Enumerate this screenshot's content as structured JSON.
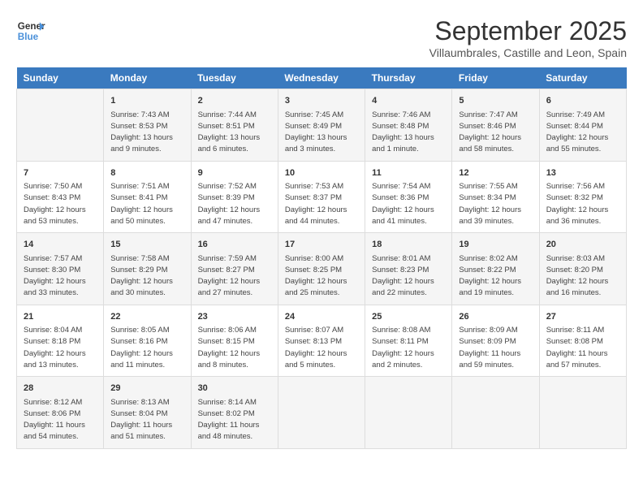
{
  "header": {
    "logo_line1": "General",
    "logo_line2": "Blue",
    "title": "September 2025",
    "subtitle": "Villaumbrales, Castille and Leon, Spain"
  },
  "weekdays": [
    "Sunday",
    "Monday",
    "Tuesday",
    "Wednesday",
    "Thursday",
    "Friday",
    "Saturday"
  ],
  "weeks": [
    [
      {
        "day": "",
        "info": ""
      },
      {
        "day": "1",
        "info": "Sunrise: 7:43 AM\nSunset: 8:53 PM\nDaylight: 13 hours\nand 9 minutes."
      },
      {
        "day": "2",
        "info": "Sunrise: 7:44 AM\nSunset: 8:51 PM\nDaylight: 13 hours\nand 6 minutes."
      },
      {
        "day": "3",
        "info": "Sunrise: 7:45 AM\nSunset: 8:49 PM\nDaylight: 13 hours\nand 3 minutes."
      },
      {
        "day": "4",
        "info": "Sunrise: 7:46 AM\nSunset: 8:48 PM\nDaylight: 13 hours\nand 1 minute."
      },
      {
        "day": "5",
        "info": "Sunrise: 7:47 AM\nSunset: 8:46 PM\nDaylight: 12 hours\nand 58 minutes."
      },
      {
        "day": "6",
        "info": "Sunrise: 7:49 AM\nSunset: 8:44 PM\nDaylight: 12 hours\nand 55 minutes."
      }
    ],
    [
      {
        "day": "7",
        "info": "Sunrise: 7:50 AM\nSunset: 8:43 PM\nDaylight: 12 hours\nand 53 minutes."
      },
      {
        "day": "8",
        "info": "Sunrise: 7:51 AM\nSunset: 8:41 PM\nDaylight: 12 hours\nand 50 minutes."
      },
      {
        "day": "9",
        "info": "Sunrise: 7:52 AM\nSunset: 8:39 PM\nDaylight: 12 hours\nand 47 minutes."
      },
      {
        "day": "10",
        "info": "Sunrise: 7:53 AM\nSunset: 8:37 PM\nDaylight: 12 hours\nand 44 minutes."
      },
      {
        "day": "11",
        "info": "Sunrise: 7:54 AM\nSunset: 8:36 PM\nDaylight: 12 hours\nand 41 minutes."
      },
      {
        "day": "12",
        "info": "Sunrise: 7:55 AM\nSunset: 8:34 PM\nDaylight: 12 hours\nand 39 minutes."
      },
      {
        "day": "13",
        "info": "Sunrise: 7:56 AM\nSunset: 8:32 PM\nDaylight: 12 hours\nand 36 minutes."
      }
    ],
    [
      {
        "day": "14",
        "info": "Sunrise: 7:57 AM\nSunset: 8:30 PM\nDaylight: 12 hours\nand 33 minutes."
      },
      {
        "day": "15",
        "info": "Sunrise: 7:58 AM\nSunset: 8:29 PM\nDaylight: 12 hours\nand 30 minutes."
      },
      {
        "day": "16",
        "info": "Sunrise: 7:59 AM\nSunset: 8:27 PM\nDaylight: 12 hours\nand 27 minutes."
      },
      {
        "day": "17",
        "info": "Sunrise: 8:00 AM\nSunset: 8:25 PM\nDaylight: 12 hours\nand 25 minutes."
      },
      {
        "day": "18",
        "info": "Sunrise: 8:01 AM\nSunset: 8:23 PM\nDaylight: 12 hours\nand 22 minutes."
      },
      {
        "day": "19",
        "info": "Sunrise: 8:02 AM\nSunset: 8:22 PM\nDaylight: 12 hours\nand 19 minutes."
      },
      {
        "day": "20",
        "info": "Sunrise: 8:03 AM\nSunset: 8:20 PM\nDaylight: 12 hours\nand 16 minutes."
      }
    ],
    [
      {
        "day": "21",
        "info": "Sunrise: 8:04 AM\nSunset: 8:18 PM\nDaylight: 12 hours\nand 13 minutes."
      },
      {
        "day": "22",
        "info": "Sunrise: 8:05 AM\nSunset: 8:16 PM\nDaylight: 12 hours\nand 11 minutes."
      },
      {
        "day": "23",
        "info": "Sunrise: 8:06 AM\nSunset: 8:15 PM\nDaylight: 12 hours\nand 8 minutes."
      },
      {
        "day": "24",
        "info": "Sunrise: 8:07 AM\nSunset: 8:13 PM\nDaylight: 12 hours\nand 5 minutes."
      },
      {
        "day": "25",
        "info": "Sunrise: 8:08 AM\nSunset: 8:11 PM\nDaylight: 12 hours\nand 2 minutes."
      },
      {
        "day": "26",
        "info": "Sunrise: 8:09 AM\nSunset: 8:09 PM\nDaylight: 11 hours\nand 59 minutes."
      },
      {
        "day": "27",
        "info": "Sunrise: 8:11 AM\nSunset: 8:08 PM\nDaylight: 11 hours\nand 57 minutes."
      }
    ],
    [
      {
        "day": "28",
        "info": "Sunrise: 8:12 AM\nSunset: 8:06 PM\nDaylight: 11 hours\nand 54 minutes."
      },
      {
        "day": "29",
        "info": "Sunrise: 8:13 AM\nSunset: 8:04 PM\nDaylight: 11 hours\nand 51 minutes."
      },
      {
        "day": "30",
        "info": "Sunrise: 8:14 AM\nSunset: 8:02 PM\nDaylight: 11 hours\nand 48 minutes."
      },
      {
        "day": "",
        "info": ""
      },
      {
        "day": "",
        "info": ""
      },
      {
        "day": "",
        "info": ""
      },
      {
        "day": "",
        "info": ""
      }
    ]
  ]
}
